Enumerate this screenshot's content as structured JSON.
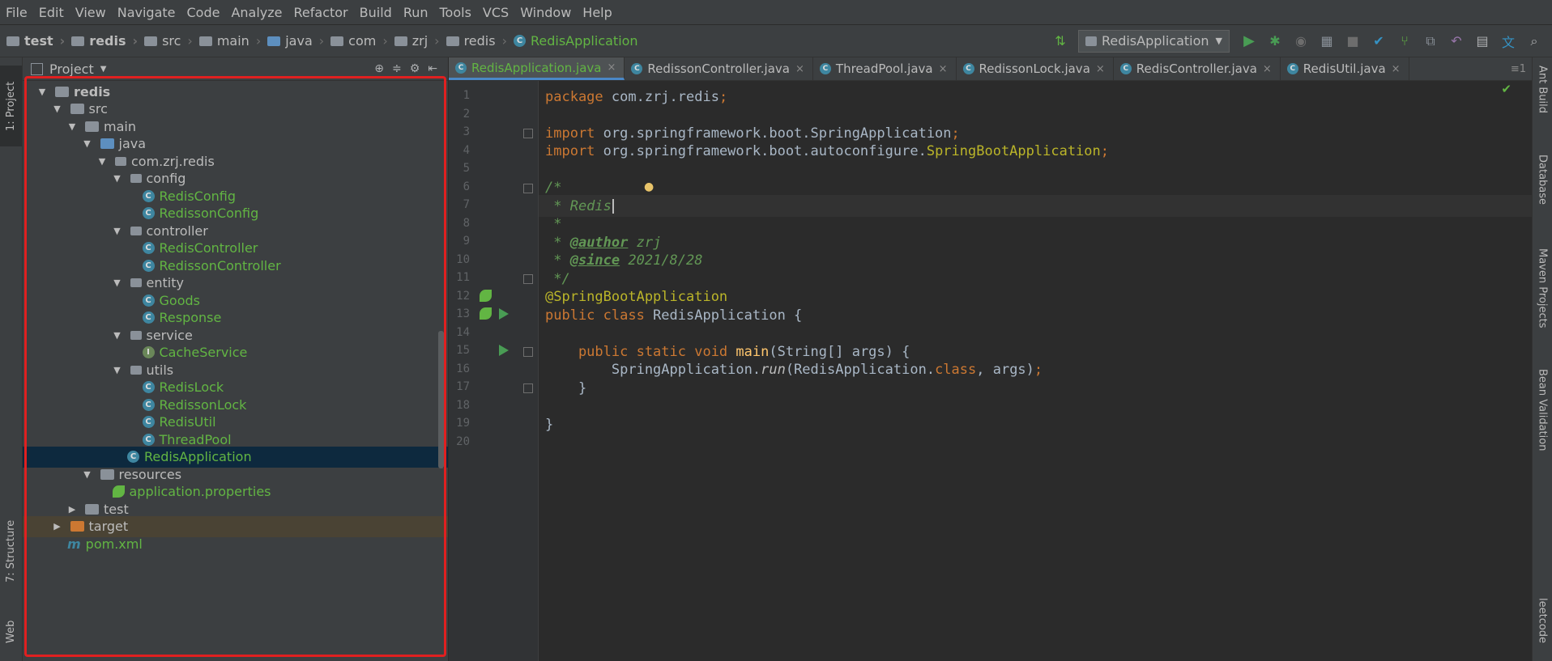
{
  "menu": [
    "File",
    "Edit",
    "View",
    "Navigate",
    "Code",
    "Analyze",
    "Refactor",
    "Build",
    "Run",
    "Tools",
    "VCS",
    "Window",
    "Help"
  ],
  "breadcrumb": [
    "test",
    "redis",
    "src",
    "main",
    "java",
    "com",
    "zrj",
    "redis",
    "RedisApplication"
  ],
  "run_config": "RedisApplication",
  "left_tabs": {
    "project": "1: Project",
    "structure": "7: Structure",
    "web": "Web"
  },
  "right_tabs": {
    "ant": "Ant Build",
    "database": "Database",
    "maven": "Maven Projects",
    "bean": "Bean Validation",
    "leetcode": "leetcode"
  },
  "project": {
    "title": "Project",
    "tree": [
      {
        "label": "redis",
        "icon": "module",
        "arrow": "▼",
        "level": 0,
        "style": "bold"
      },
      {
        "label": "src",
        "icon": "folder",
        "arrow": "▼",
        "level": 1
      },
      {
        "label": "main",
        "icon": "folder",
        "arrow": "▼",
        "level": 2
      },
      {
        "label": "java",
        "icon": "source-folder",
        "arrow": "▼",
        "level": 3
      },
      {
        "label": "com.zrj.redis",
        "icon": "package",
        "arrow": "▼",
        "level": 4
      },
      {
        "label": "config",
        "icon": "package",
        "arrow": "▼",
        "level": 5
      },
      {
        "label": "RedisConfig",
        "icon": "class",
        "level": 7,
        "style": "green"
      },
      {
        "label": "RedissonConfig",
        "icon": "class",
        "level": 7,
        "style": "green"
      },
      {
        "label": "controller",
        "icon": "package",
        "arrow": "▼",
        "level": 5
      },
      {
        "label": "RedisController",
        "icon": "class",
        "level": 7,
        "style": "green"
      },
      {
        "label": "RedissonController",
        "icon": "class",
        "level": 7,
        "style": "green"
      },
      {
        "label": "entity",
        "icon": "package",
        "arrow": "▼",
        "level": 5
      },
      {
        "label": "Goods",
        "icon": "class",
        "level": 7,
        "style": "green"
      },
      {
        "label": "Response",
        "icon": "class",
        "level": 7,
        "style": "green"
      },
      {
        "label": "service",
        "icon": "package",
        "arrow": "▼",
        "level": 5
      },
      {
        "label": "CacheService",
        "icon": "interface",
        "level": 7,
        "style": "green"
      },
      {
        "label": "utils",
        "icon": "package",
        "arrow": "▼",
        "level": 5
      },
      {
        "label": "RedisLock",
        "icon": "class",
        "level": 7,
        "style": "green"
      },
      {
        "label": "RedissonLock",
        "icon": "class",
        "level": 7,
        "style": "green"
      },
      {
        "label": "RedisUtil",
        "icon": "class",
        "level": 7,
        "style": "green"
      },
      {
        "label": "ThreadPool",
        "icon": "class",
        "level": 7,
        "style": "green"
      },
      {
        "label": "RedisApplication",
        "icon": "class",
        "level": 6,
        "style": "green",
        "selected": true
      },
      {
        "label": "resources",
        "icon": "folder",
        "arrow": "▼",
        "level": 3
      },
      {
        "label": "application.properties",
        "icon": "spring-leaf",
        "level": 5,
        "style": "green"
      },
      {
        "label": "test",
        "icon": "folder",
        "arrow": "▶",
        "level": 2
      },
      {
        "label": "target",
        "icon": "folder-orange",
        "arrow": "▶",
        "level": 1,
        "excluded": true
      },
      {
        "label": "pom.xml",
        "icon": "maven",
        "level": 2,
        "style": "green"
      }
    ]
  },
  "tabs": [
    {
      "label": "RedisApplication.java",
      "active": true
    },
    {
      "label": "RedissonController.java"
    },
    {
      "label": "ThreadPool.java"
    },
    {
      "label": "RedissonLock.java"
    },
    {
      "label": "RedisController.java"
    },
    {
      "label": "RedisUtil.java"
    }
  ],
  "tabs_menu": "≡1",
  "code": {
    "line_numbers": [
      "1",
      "2",
      "3",
      "4",
      "5",
      "6",
      "7",
      "8",
      "9",
      "10",
      "11",
      "12",
      "13",
      "14",
      "15",
      "16",
      "17",
      "18",
      "19",
      "20"
    ],
    "lines": [
      [
        {
          "t": "package ",
          "c": "kw"
        },
        {
          "t": "com.zrj.redis",
          "c": "str"
        },
        {
          "t": ";",
          "c": "kw"
        }
      ],
      [],
      [
        {
          "t": "import ",
          "c": "kw"
        },
        {
          "t": "org.springframework.boot.SpringApplication",
          "c": "str"
        },
        {
          "t": ";",
          "c": "kw"
        }
      ],
      [
        {
          "t": "import ",
          "c": "kw"
        },
        {
          "t": "org.springframework.boot.autoconfigure.",
          "c": "str"
        },
        {
          "t": "SpringBootApplication",
          "c": "ann"
        },
        {
          "t": ";",
          "c": "kw"
        }
      ],
      [],
      [
        {
          "t": "/",
          "c": "cm"
        },
        {
          "t": "*",
          "c": "cm"
        }
      ],
      [
        {
          "t": " * Redis",
          "c": "cm"
        }
      ],
      [
        {
          "t": " *",
          "c": "cm"
        }
      ],
      [
        {
          "t": " * ",
          "c": "cm"
        },
        {
          "t": "@author",
          "c": "tag"
        },
        {
          "t": " zrj",
          "c": "cm"
        }
      ],
      [
        {
          "t": " * ",
          "c": "cm"
        },
        {
          "t": "@since",
          "c": "tag"
        },
        {
          "t": " 2021/8/28",
          "c": "cm"
        }
      ],
      [
        {
          "t": " */",
          "c": "cm"
        }
      ],
      [
        {
          "t": "@SpringBootApplication",
          "c": "ann"
        }
      ],
      [
        {
          "t": "public class ",
          "c": "kw"
        },
        {
          "t": "RedisApplication {",
          "c": "str"
        }
      ],
      [],
      [
        {
          "t": "    public static void ",
          "c": "kw"
        },
        {
          "t": "main",
          "c": "mth"
        },
        {
          "t": "(String[] args) {",
          "c": "str"
        }
      ],
      [
        {
          "t": "        SpringApplication.",
          "c": "str"
        },
        {
          "t": "run",
          "c": "it"
        },
        {
          "t": "(RedisApplication.",
          "c": "str"
        },
        {
          "t": "class",
          "c": "kw"
        },
        {
          "t": ", args)",
          "c": "str"
        },
        {
          "t": ";",
          "c": "kw"
        }
      ],
      [
        {
          "t": "    }",
          "c": "str"
        }
      ],
      [],
      [
        {
          "t": "}",
          "c": "str"
        }
      ],
      []
    ]
  },
  "colors": {
    "accent": "#4a88c7",
    "highlight_box": "#e02020",
    "green_text": "#62b543"
  }
}
